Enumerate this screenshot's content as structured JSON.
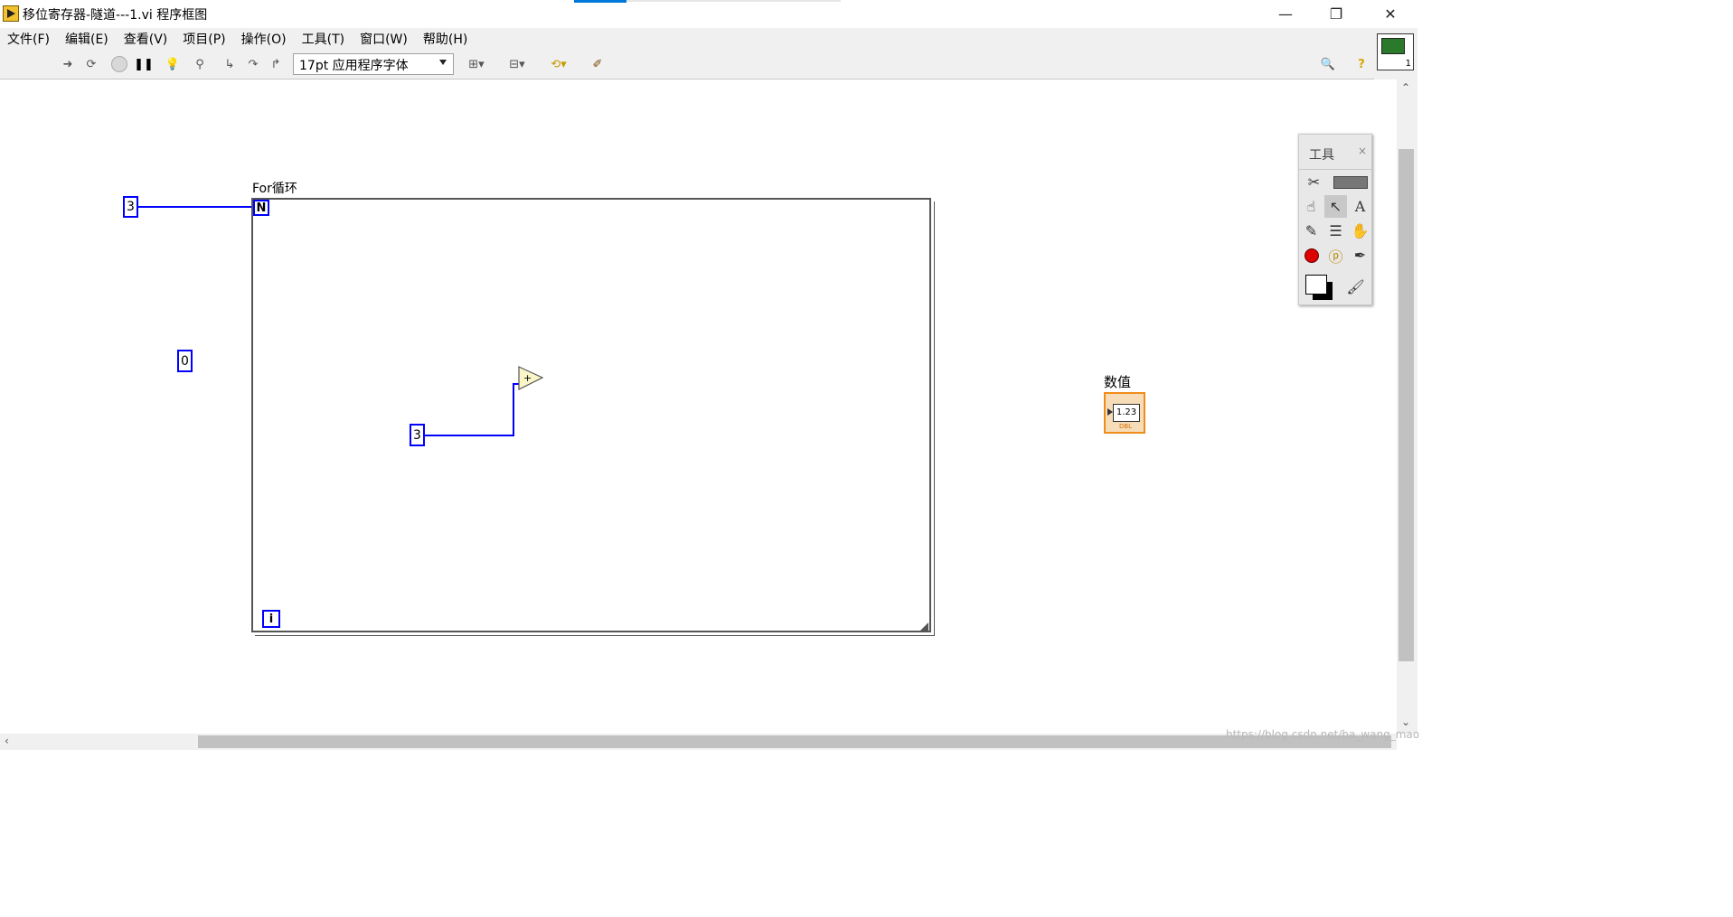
{
  "window": {
    "title": "移位寄存器-隧道---1.vi 程序框图",
    "minimize": "—",
    "maximize": "❐",
    "close": "✕"
  },
  "menu": {
    "items": [
      "文件(F)",
      "编辑(E)",
      "查看(V)",
      "项目(P)",
      "操作(O)",
      "工具(T)",
      "窗口(W)",
      "帮助(H)"
    ]
  },
  "toolbar": {
    "font_select": "17pt 应用程序字体",
    "corner_number": "1"
  },
  "diagram": {
    "loop_label": "For循环",
    "loop_count_terminal": "N",
    "iteration_terminal": "i",
    "const_count": "3",
    "const_zero": "0",
    "const_inner": "3",
    "add_symbol": "+",
    "numeric_label": "数值",
    "numeric_display": "1.23",
    "numeric_type": "DBL",
    "wire_color": "#0000ff",
    "indicator_color": "#f08c1a"
  },
  "tools_palette": {
    "title": "工具",
    "close": "×"
  },
  "watermark": "https://blog.csdn.net/ba_wang_mao"
}
